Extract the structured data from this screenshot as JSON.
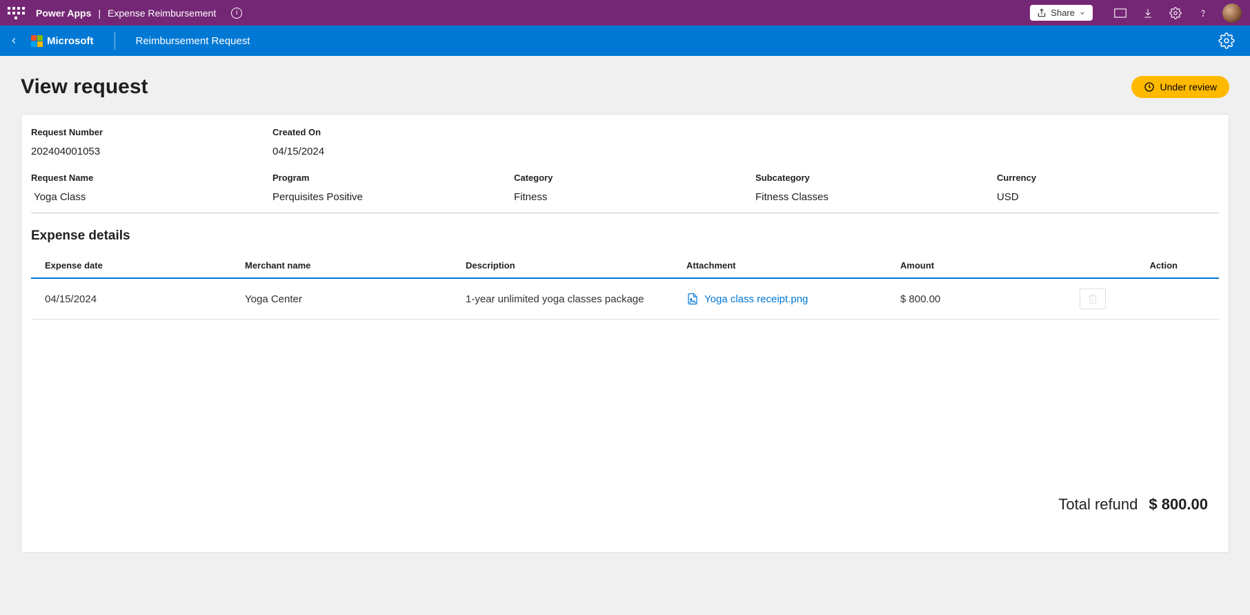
{
  "topbar": {
    "product": "Power Apps",
    "separator": "|",
    "app_name": "Expense Reimbursement",
    "share_label": "Share"
  },
  "appbar": {
    "brand": "Microsoft",
    "screen_title": "Reimbursement Request"
  },
  "page": {
    "title": "View request",
    "status_text": "Under review"
  },
  "request": {
    "number_label": "Request Number",
    "number_value": "202404001053",
    "created_label": "Created On",
    "created_value": "04/15/2024",
    "name_label": "Request Name",
    "name_value": "Yoga Class",
    "program_label": "Program",
    "program_value": "Perquisites Positive",
    "category_label": "Category",
    "category_value": "Fitness",
    "subcategory_label": "Subcategory",
    "subcategory_value": "Fitness Classes",
    "currency_label": "Currency",
    "currency_value": "USD"
  },
  "expense": {
    "section_title": "Expense details",
    "headers": {
      "date": "Expense date",
      "merchant": "Merchant name",
      "description": "Description",
      "attachment": "Attachment",
      "amount": "Amount",
      "action": "Action"
    },
    "rows": [
      {
        "date": "04/15/2024",
        "merchant": "Yoga Center",
        "description": "1-year unlimited yoga classes package",
        "attachment": "Yoga class receipt.png",
        "amount": "$ 800.00"
      }
    ],
    "total_label": "Total refund",
    "total_value": "$ 800.00"
  }
}
